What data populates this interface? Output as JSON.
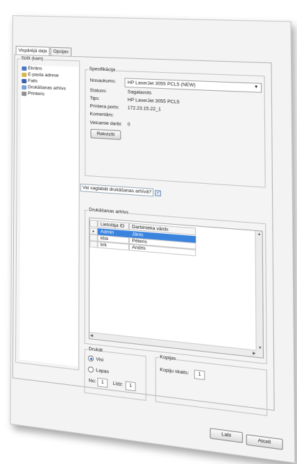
{
  "tabs": [
    "Vispārējā daļa",
    "Opcijas"
  ],
  "settings_tree": {
    "title": "Sūtīt (kam)",
    "items": [
      {
        "label": "Ekrāns",
        "icon": "screen-icon"
      },
      {
        "label": "E-pasta adrese",
        "icon": "mail-icon"
      },
      {
        "label": "Fails",
        "icon": "file-icon"
      },
      {
        "label": "Drukāšanas arhīvs",
        "icon": "archive-icon"
      },
      {
        "label": "Printeris",
        "icon": "printer-icon"
      }
    ]
  },
  "specification": {
    "title": "Specifikācija",
    "name_label": "Nosaukums:",
    "name_value": "HP LaserJet 3055 PCL5 (NEW)",
    "status_label": "Statuss:",
    "status_value": "Sagatavots",
    "type_label": "Tips:",
    "type_value": "HP LaserJet 3055 PCL5",
    "port_label": "Printera ports:",
    "port_value": "172.23.15.22_1",
    "comments_label": "Komentārs:",
    "comments_value": "",
    "pending_label": "Veicamie darbi:",
    "pending_value": "0",
    "props_button": "Rekvizīti"
  },
  "save_archive": {
    "label": "Vai saglabāt drukāšanas arhīvā?",
    "checked": true,
    "check_glyph": "✓"
  },
  "print_archive": {
    "title": "Drukāšanas arhīvs",
    "columns": [
      "Lietotāja ID",
      "Darbinieka vārds"
    ],
    "rows": [
      {
        "id": "Admin",
        "name": "Jānis",
        "selected": true
      },
      {
        "id": "kba",
        "name": "Pēteris",
        "selected": false
      },
      {
        "id": "krk",
        "name": "Andris",
        "selected": false
      }
    ]
  },
  "print_range": {
    "title": "Drukāt",
    "all_label": "Visi",
    "pages_label": "Lapas",
    "from_label": "No:",
    "from_value": "1",
    "to_label": "Līdz:",
    "to_value": "1"
  },
  "copies": {
    "title": "Kopijas",
    "count_label": "Kopiju skaits:",
    "count_value": "1"
  },
  "buttons": {
    "ok": "Labi",
    "cancel": "Atcelt"
  },
  "colors": {
    "selection": "#3b84de"
  }
}
